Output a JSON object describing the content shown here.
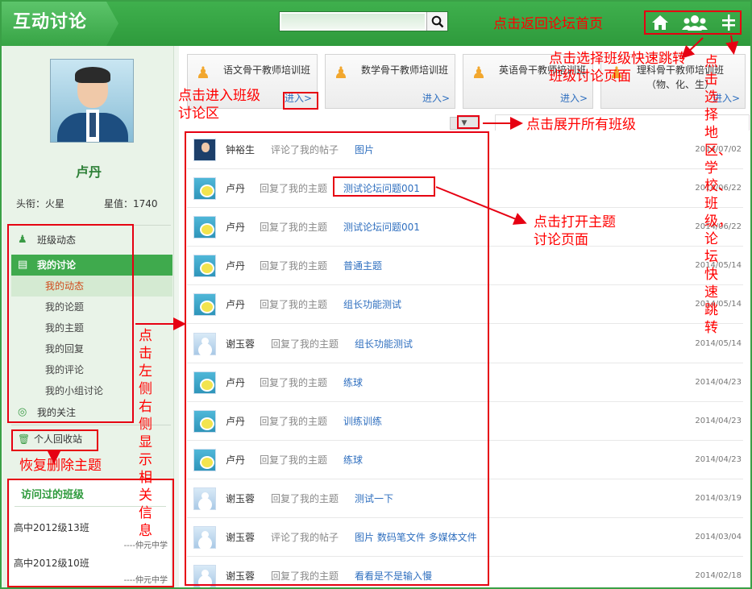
{
  "header": {
    "logo": "互动讨论",
    "search": {
      "placeholder": ""
    }
  },
  "user": {
    "name": "卢丹",
    "rank_label": "头衔：火星",
    "star_label": "星值：1740"
  },
  "sidebar": {
    "nav": [
      {
        "label": "班级动态",
        "icon": "group-icon"
      },
      {
        "label": "我的讨论",
        "icon": "chat-icon",
        "active": true
      },
      {
        "label": "我的关注",
        "icon": "target-icon"
      }
    ],
    "sub": [
      "我的动态",
      "我的论题",
      "我的主题",
      "我的回复",
      "我的评论",
      "我的小组讨论"
    ],
    "recycle": "个人回收站",
    "visited": {
      "title": "访问过的班级",
      "items": [
        {
          "name": "高中2012级13班",
          "school": "----仲元中学"
        },
        {
          "name": "高中2012级10班",
          "school": "----仲元中学"
        }
      ]
    }
  },
  "classes": [
    {
      "name": "语文骨干教师培训班",
      "enter": "进入>"
    },
    {
      "name": "数学骨干教师培训班",
      "enter": "进入>"
    },
    {
      "name": "英语骨干教师培训班",
      "enter": "进入>"
    },
    {
      "name": "理科骨干教师培训班（物、化、生）",
      "enter": "进入>"
    }
  ],
  "feed": [
    {
      "who": "钟裕生",
      "action": "评论了我的帖子",
      "target": "图片",
      "date": "2014/07/02",
      "avatar": "photo"
    },
    {
      "who": "卢丹",
      "action": "回复了我的主题",
      "target": "测试论坛问题001",
      "date": "2014/06/22",
      "avatar": "snail"
    },
    {
      "who": "卢丹",
      "action": "回复了我的主题",
      "target": "测试论坛问题001",
      "date": "2014/06/22",
      "avatar": "snail"
    },
    {
      "who": "卢丹",
      "action": "回复了我的主题",
      "target": "普通主题",
      "date": "2014/05/14",
      "avatar": "snail"
    },
    {
      "who": "卢丹",
      "action": "回复了我的主题",
      "target": "组长功能测试",
      "date": "2014/05/14",
      "avatar": "snail"
    },
    {
      "who": "谢玉蓉",
      "action": "回复了我的主题",
      "target": "组长功能测试",
      "date": "2014/05/14",
      "avatar": "person"
    },
    {
      "who": "卢丹",
      "action": "回复了我的主题",
      "target": "练球",
      "date": "2014/04/23",
      "avatar": "snail"
    },
    {
      "who": "卢丹",
      "action": "回复了我的主题",
      "target": "训练训练",
      "date": "2014/04/23",
      "avatar": "snail"
    },
    {
      "who": "卢丹",
      "action": "回复了我的主题",
      "target": "练球",
      "date": "2014/04/23",
      "avatar": "snail"
    },
    {
      "who": "谢玉蓉",
      "action": "回复了我的主题",
      "target": "测试一下",
      "date": "2014/03/19",
      "avatar": "person"
    },
    {
      "who": "谢玉蓉",
      "action": "评论了我的帖子",
      "target": "图片 数码笔文件 多媒体文件",
      "date": "2014/03/04",
      "avatar": "person"
    },
    {
      "who": "谢玉蓉",
      "action": "回复了我的主题",
      "target": "看看是不是输入慢",
      "date": "2014/02/18",
      "avatar": "person"
    }
  ],
  "annotations": {
    "home": "点击返回论坛首页",
    "class_quick": "点击选择班级快速跳转班级讨论页面",
    "region_chars": [
      "点",
      "击",
      "选",
      "择",
      "地",
      "区、",
      "学",
      "校、",
      "班",
      "级，",
      "论",
      "坛",
      "快",
      "速",
      "跳",
      "转"
    ],
    "enter_class": "点击进入班级讨论区",
    "expand": "点击展开所有班级",
    "open_topic": "点击打开主题讨论页面",
    "left_right_chars": [
      "点",
      "击",
      "左",
      "侧",
      "右",
      "侧",
      "显",
      "示",
      "相",
      "关",
      "信",
      "息"
    ],
    "restore": "恢复删除主题"
  },
  "colors": {
    "brand": "#3aa046",
    "annotation": "#e60012",
    "link": "#2f6fbf"
  }
}
